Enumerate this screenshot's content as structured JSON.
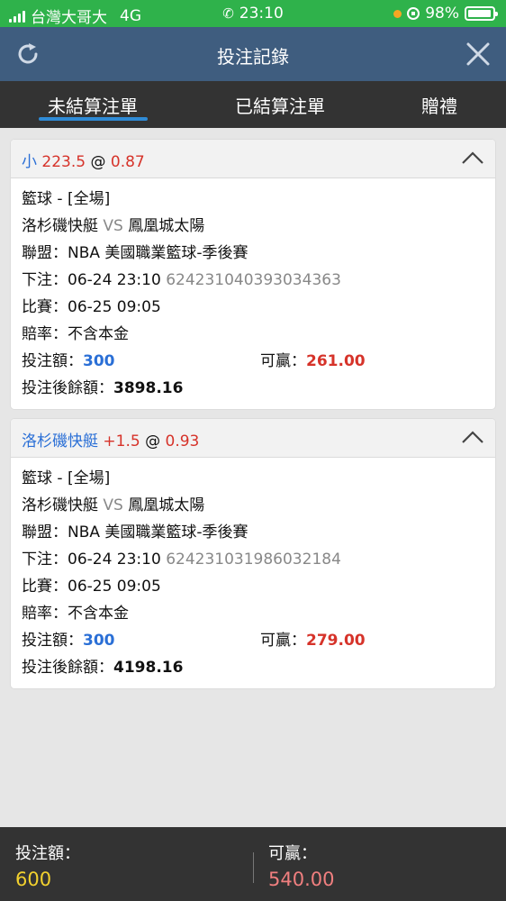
{
  "status_bar": {
    "carrier": "台灣大哥大",
    "network": "4G",
    "time": "23:10",
    "battery": "98%",
    "battery_level": 0.98,
    "icons": [
      "signal-icon",
      "phone-icon",
      "orange-dot-icon",
      "rotation-lock-icon",
      "battery-charging-icon"
    ]
  },
  "header": {
    "title": "投注記錄",
    "left_icon": "refresh-icon",
    "right_icon": "close-icon"
  },
  "tabs": [
    {
      "label": "未結算注單",
      "active": true
    },
    {
      "label": "已結算注單",
      "active": false
    },
    {
      "label": "贈禮",
      "active": false
    }
  ],
  "bets": [
    {
      "selection": "小",
      "line": "223.5",
      "at": "@",
      "odds": "0.87",
      "sport_line": "籃球 - [全場]",
      "team_home": "洛杉磯快艇",
      "vs": "VS",
      "team_away": "鳳凰城太陽",
      "league_label": "聯盟：",
      "league": "NBA 美國職業籃球-季後賽",
      "bet_time_label": "下注：",
      "bet_time": "06-24 23:10",
      "ticket_id": "624231040393034363",
      "match_time_label": "比賽：",
      "match_time": "06-25 09:05",
      "odds_type_label": "賠率：",
      "odds_type": "不含本金",
      "stake_label": "投注額：",
      "stake": "300",
      "win_label": "可贏：",
      "win": "261.00",
      "balance_label": "投注後餘額：",
      "balance": "3898.16"
    },
    {
      "selection": "洛杉磯快艇",
      "line": "+1.5",
      "at": "@",
      "odds": "0.93",
      "sport_line": "籃球 - [全場]",
      "team_home": "洛杉磯快艇",
      "vs": "VS",
      "team_away": "鳳凰城太陽",
      "league_label": "聯盟：",
      "league": "NBA 美國職業籃球-季後賽",
      "bet_time_label": "下注：",
      "bet_time": "06-24 23:10",
      "ticket_id": "624231031986032184",
      "match_time_label": "比賽：",
      "match_time": "06-25 09:05",
      "odds_type_label": "賠率：",
      "odds_type": "不含本金",
      "stake_label": "投注額：",
      "stake": "300",
      "win_label": "可贏：",
      "win": "279.00",
      "balance_label": "投注後餘額：",
      "balance": "4198.16"
    }
  ],
  "footer": {
    "stake_label": "投注額：",
    "stake_total": "600",
    "win_label": "可贏：",
    "win_total": "540.00"
  },
  "colors": {
    "status_green": "#2fb24b",
    "header_blue": "#3f5d7f",
    "tab_bar": "#333333",
    "tab_active_underline": "#2f8bd6",
    "accent_blue": "#2a6fd6",
    "accent_red": "#d6332a",
    "footer_yellow": "#f2d12e",
    "footer_pink": "#f07f7f"
  }
}
